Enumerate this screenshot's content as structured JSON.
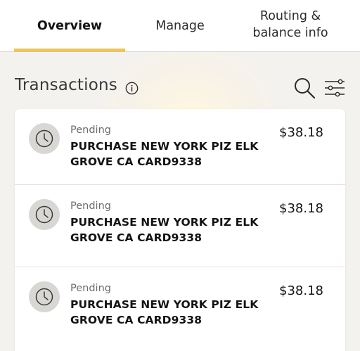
{
  "tabs": [
    {
      "label": "Overview",
      "active": true
    },
    {
      "label": "Manage",
      "active": false
    },
    {
      "label": "Routing &\nbalance info",
      "active": false
    }
  ],
  "colors": {
    "accent": "#f2c44a",
    "background": "#f4f2ef",
    "card": "#ffffff",
    "icon_circle": "#d9d7d4"
  },
  "transactions_section": {
    "title": "Transactions",
    "icons": [
      "info-icon",
      "search-icon",
      "filter-icon"
    ]
  },
  "transactions": [
    {
      "status": "Pending",
      "description": "PURCHASE NEW YORK PIZ ELK GROVE CA CARD9338",
      "amount": "$38.18",
      "icon": "clock-icon"
    },
    {
      "status": "Pending",
      "description": "PURCHASE NEW YORK PIZ ELK GROVE CA CARD9338",
      "amount": "$38.18",
      "icon": "clock-icon"
    },
    {
      "status": "Pending",
      "description": "PURCHASE NEW YORK PIZ ELK GROVE CA CARD9338",
      "amount": "$38.18",
      "icon": "clock-icon"
    }
  ]
}
